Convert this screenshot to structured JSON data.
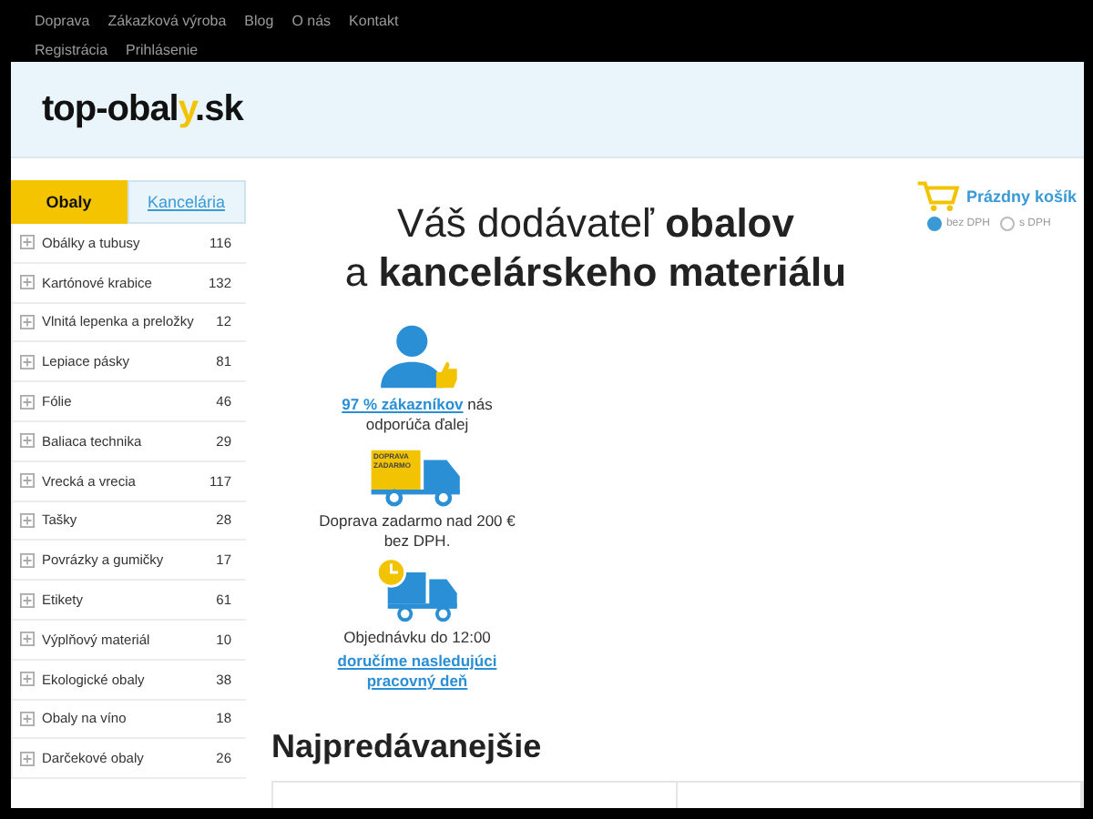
{
  "top_nav": [
    {
      "label": "Doprava"
    },
    {
      "label": "Zákazková výroba"
    },
    {
      "label": "Blog"
    },
    {
      "label": "O nás"
    },
    {
      "label": "Kontakt"
    },
    {
      "label": "Registrácia"
    },
    {
      "label": "Prihlásenie"
    }
  ],
  "logo": {
    "main": "top-obal",
    "accent": "y",
    "suffix": ".sk"
  },
  "category_tabs": [
    {
      "label": "Obaly",
      "selected": true
    },
    {
      "label": "Kancelária",
      "selected": false
    }
  ],
  "categories": [
    {
      "name": "Obálky a tubusy",
      "count": "116"
    },
    {
      "name": "Kartónové krabice",
      "count": "132"
    },
    {
      "name": "Vlnitá lepenka a preložky",
      "count": "12"
    },
    {
      "name": "Lepiace pásky",
      "count": "81"
    },
    {
      "name": "Fólie",
      "count": "46"
    },
    {
      "name": "Baliaca technika",
      "count": "29"
    },
    {
      "name": "Vrecká a vrecia",
      "count": "117"
    },
    {
      "name": "Tašky",
      "count": "28"
    },
    {
      "name": "Povrázky a gumičky",
      "count": "17"
    },
    {
      "name": "Etikety",
      "count": "61"
    },
    {
      "name": "Výplňový materiál",
      "count": "10"
    },
    {
      "name": "Ekologické obaly",
      "count": "38"
    },
    {
      "name": "Obaly na víno",
      "count": "18"
    },
    {
      "name": "Darčekové obaly",
      "count": "26"
    }
  ],
  "cart": {
    "label": "Prázdny košík",
    "price_modes": [
      {
        "label": "bez DPH",
        "selected": true
      },
      {
        "label": "s DPH",
        "selected": false
      }
    ]
  },
  "headline": {
    "line1": "Váš dodávateľ **obalov**",
    "line2": "a **kancelárskeho materiálu**"
  },
  "features": [
    {
      "kind": "customers",
      "link": "97 % zákazníkov",
      "text": "nás odporúča ďalej"
    },
    {
      "kind": "free-shipping",
      "badge": "DOPRAVA ZADARMO",
      "text": "Doprava zadarmo nad 200 € bez DPH."
    },
    {
      "kind": "next-day",
      "text": "Objednávku do 12:00",
      "link": "doručíme nasledujúci pracovný deň"
    }
  ],
  "bestsellers": {
    "title": "Najpredávanejšie"
  }
}
